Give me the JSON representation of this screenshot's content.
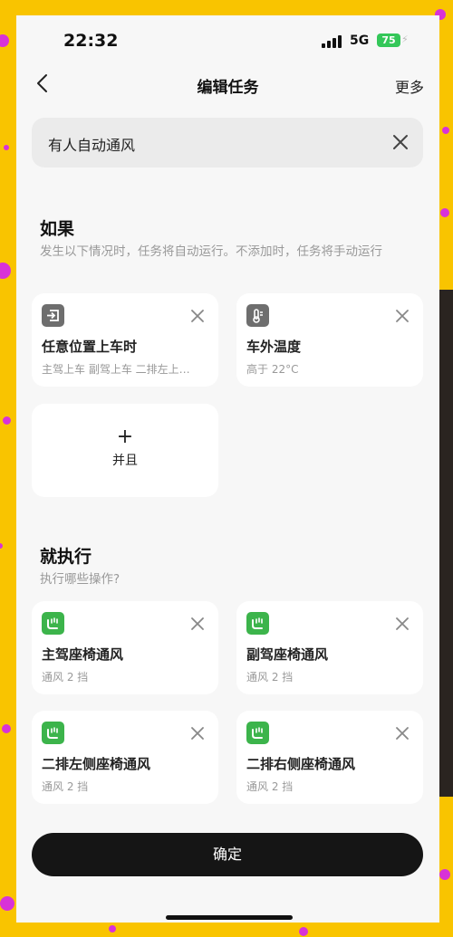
{
  "status_bar": {
    "time": "22:32",
    "network": "5G",
    "battery": "75"
  },
  "nav": {
    "title": "编辑任务",
    "more": "更多"
  },
  "task_name": {
    "value": "有人自动通风"
  },
  "if_section": {
    "title": "如果",
    "description": "发生以下情况时，任务将自动运行。不添加时，任务将手动运行",
    "conditions": [
      {
        "title": "任意位置上车时",
        "subtitle": "主驾上车 副驾上车 二排左上…",
        "icon": "door-enter-icon"
      },
      {
        "title": "车外温度",
        "subtitle": "高于 22°C",
        "icon": "thermometer-icon"
      }
    ],
    "add_label": "并且",
    "add_symbol": "+"
  },
  "then_section": {
    "title": "就执行",
    "description": "执行哪些操作?",
    "actions": [
      {
        "title": "主驾座椅通风",
        "subtitle": "通风 2 挡",
        "icon": "seat-ventilation-icon"
      },
      {
        "title": "副驾座椅通风",
        "subtitle": "通风 2 挡",
        "icon": "seat-ventilation-icon"
      },
      {
        "title": "二排左侧座椅通风",
        "subtitle": "通风 2 挡",
        "icon": "seat-ventilation-icon"
      },
      {
        "title": "二排右侧座椅通风",
        "subtitle": "通风 2 挡",
        "icon": "seat-ventilation-icon"
      }
    ]
  },
  "confirm_label": "确定",
  "colors": {
    "battery": "#34c759",
    "action_icon": "#3cb44b",
    "condition_icon": "#6e6e6e",
    "button": "#151515",
    "background": "#f9c400"
  }
}
